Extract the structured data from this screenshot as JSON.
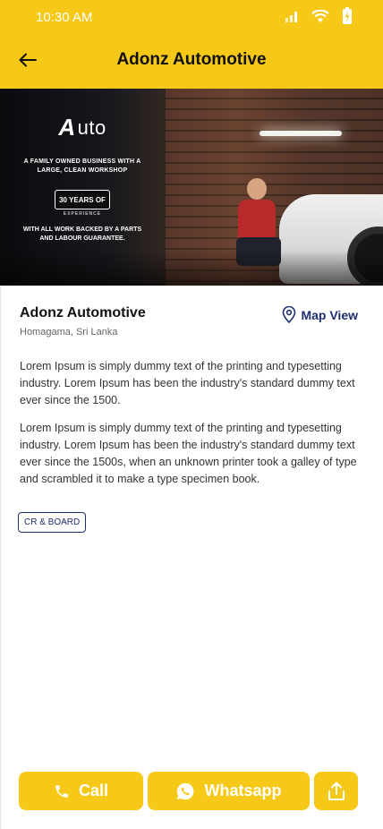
{
  "status_bar": {
    "time": "10:30 AM",
    "icons": [
      "signal-icon",
      "wifi-icon",
      "battery-charging-icon"
    ]
  },
  "header": {
    "title": "Adonz Automotive",
    "back_icon": "arrow-left-icon",
    "background_color": "#F6C817"
  },
  "banner": {
    "logo_text": "uto",
    "logo_mark": "A",
    "headline": "A FAMILY OWNED BUSINESS WITH A LARGE, CLEAN WORKSHOP",
    "badge": "30 YEARS OF",
    "badge_sub": "EXPERIENCE",
    "guarantee": "WITH ALL WORK BACKED BY A PARTS AND LABOUR GUARANTEE.",
    "slides_count": 3,
    "active_slide": 1
  },
  "business": {
    "name": "Adonz Automotive",
    "location": "Homagama, Sri Lanka",
    "map_view_label": "Map View",
    "map_icon": "location-pin-icon",
    "description_1": "Lorem Ipsum is simply dummy text of the printing and typesetting industry. Lorem Ipsum has been the industry's standard dummy text ever since the 1500.",
    "description_2": "Lorem Ipsum is simply dummy text of the printing and typesetting industry. Lorem Ipsum has been the industry's standard dummy text ever since the 1500s, when an unknown printer took a galley of type and scrambled it to make a type specimen book.",
    "tags": [
      "CR & BOARD"
    ]
  },
  "actions": {
    "call_label": "Call",
    "call_icon": "phone-icon",
    "whatsapp_label": "Whatsapp",
    "whatsapp_icon": "whatsapp-icon",
    "share_icon": "share-icon",
    "button_color": "#F6C817"
  },
  "colors": {
    "accent": "#F6C817",
    "link": "#1f2f6e"
  }
}
